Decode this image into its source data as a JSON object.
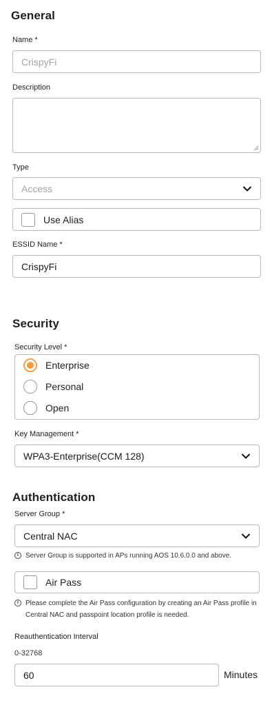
{
  "general": {
    "heading": "General",
    "name_label": "Name *",
    "name_placeholder": "CrispyFi",
    "description_label": "Description",
    "description_value": "",
    "type_label": "Type",
    "type_placeholder": "Access",
    "use_alias_label": "Use Alias",
    "essid_label": "ESSID Name *",
    "essid_value": "CrispyFi"
  },
  "security": {
    "heading": "Security",
    "level_label": "Security Level *",
    "levels": [
      {
        "label": "Enterprise",
        "selected": true
      },
      {
        "label": "Personal",
        "selected": false
      },
      {
        "label": "Open",
        "selected": false
      }
    ],
    "key_mgmt_label": "Key Management *",
    "key_mgmt_value": "WPA3-Enterprise(CCM 128)"
  },
  "authentication": {
    "heading": "Authentication",
    "server_group_label": "Server Group *",
    "server_group_value": "Central NAC",
    "server_group_note": "Server Group is supported in APs running AOS 10.6.0.0 and above.",
    "air_pass_label": "Air Pass",
    "air_pass_note": "Please complete the Air Pass configuration by creating an Air Pass profile in Central NAC and passpoint location profile is needed.",
    "reauth_label": "Reauthentication Interval",
    "reauth_range": "0-32768",
    "reauth_value": "60",
    "reauth_unit": "Minutes"
  },
  "colors": {
    "accent": "#f79b3b",
    "border": "#b9b9b9"
  },
  "icons": {
    "dropdown": "chevron-down-icon",
    "info": "info-icon"
  }
}
